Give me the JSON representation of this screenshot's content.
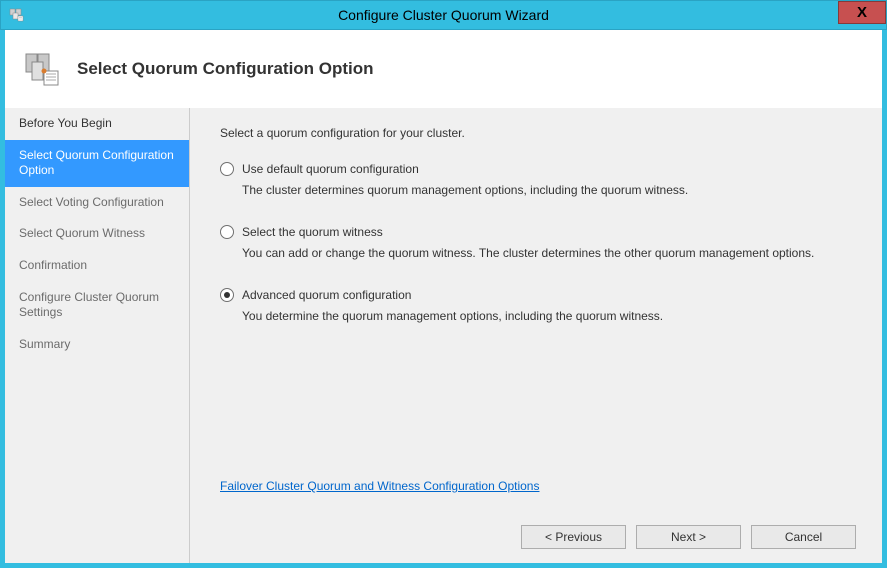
{
  "titlebar": {
    "title": "Configure Cluster Quorum Wizard",
    "close": "X"
  },
  "header": {
    "page_title": "Select Quorum Configuration Option"
  },
  "sidebar": {
    "items": [
      {
        "label": "Before You Begin"
      },
      {
        "label": "Select Quorum Configuration Option"
      },
      {
        "label": "Select Voting Configuration"
      },
      {
        "label": "Select Quorum Witness"
      },
      {
        "label": "Confirmation"
      },
      {
        "label": "Configure Cluster Quorum Settings"
      },
      {
        "label": "Summary"
      }
    ]
  },
  "content": {
    "instruction": "Select a quorum configuration for your cluster.",
    "options": [
      {
        "label": "Use default quorum configuration",
        "desc": "The cluster determines quorum management options, including the quorum witness."
      },
      {
        "label": "Select the quorum witness",
        "desc": "You can add or change the quorum witness. The cluster determines the other quorum management options."
      },
      {
        "label": "Advanced quorum configuration",
        "desc": "You determine the quorum management options, including the quorum witness."
      }
    ],
    "help_link": "Failover Cluster Quorum and Witness Configuration Options"
  },
  "buttons": {
    "previous": "< Previous",
    "next": "Next >",
    "cancel": "Cancel"
  }
}
